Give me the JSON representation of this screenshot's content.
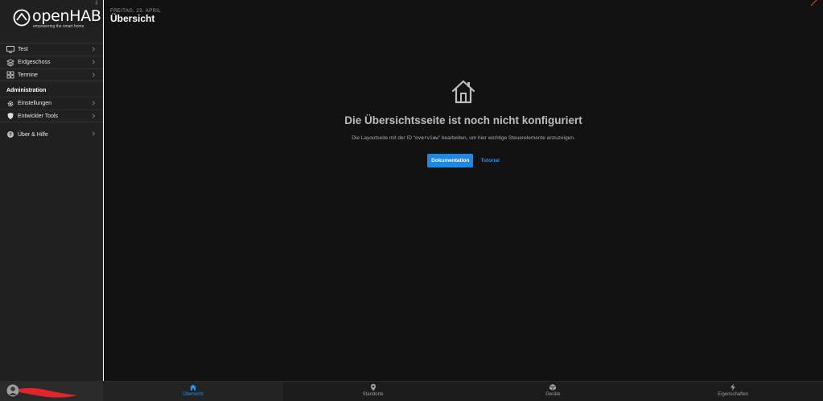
{
  "colors": {
    "accent": "#2196f3",
    "sidebar_bg": "#202020",
    "main_bg": "#121212"
  },
  "brand": {
    "name": "openHAB",
    "tagline": "empowering the smart home"
  },
  "sidebar": {
    "items": [
      {
        "label": "Test",
        "icon": "monitor-icon"
      },
      {
        "label": "Erdgeschoss",
        "icon": "layers-icon"
      },
      {
        "label": "Termine",
        "icon": "grid-icon"
      }
    ],
    "admin_title": "Administration",
    "admin_items": [
      {
        "label": "Einstellungen",
        "icon": "gear-icon"
      },
      {
        "label": "Entwickler Tools",
        "icon": "shield-icon"
      }
    ],
    "help_item": {
      "label": "Über & Hilfe",
      "icon": "help-icon"
    }
  },
  "header": {
    "date": "FREITAG, 23. APRIL",
    "title": "Übersicht"
  },
  "empty_state": {
    "icon": "house-icon",
    "heading": "Die Übersichtsseite ist noch nicht konfiguriert",
    "desc_before": "Die Layoutseite mit der ID “",
    "desc_code": "overview",
    "desc_after": "” bearbeiten, um hier wichtige Steuerelemente anzuzeigen.",
    "primary_button": "Dokumentation",
    "link_button": "Tutorial"
  },
  "tabbar": {
    "tabs": [
      {
        "label": "Übersicht",
        "icon": "home-icon",
        "active": true
      },
      {
        "label": "Standorte",
        "icon": "location-pin-icon",
        "active": false
      },
      {
        "label": "Geräte",
        "icon": "cube-icon",
        "active": false
      },
      {
        "label": "Eigenschaften",
        "icon": "lightning-icon",
        "active": false
      }
    ]
  }
}
